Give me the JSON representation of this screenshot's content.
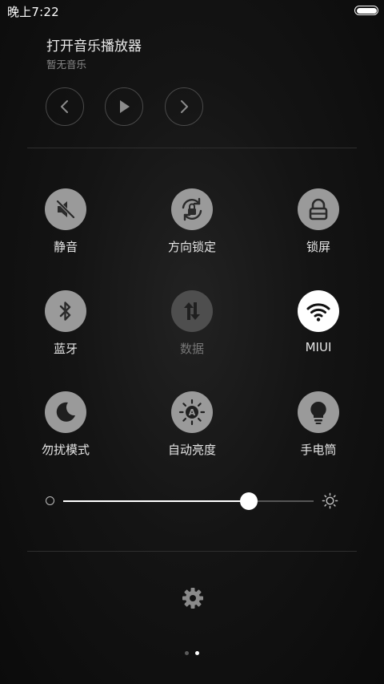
{
  "status_bar": {
    "time": "晚上7:22",
    "battery_level": 1.0
  },
  "music": {
    "title": "打开音乐播放器",
    "subtitle": "暂无音乐",
    "controls": [
      "chevron-left-icon",
      "play-icon",
      "chevron-right-icon"
    ]
  },
  "toggles": [
    {
      "label": "静音",
      "icon": "mute-icon",
      "state": "off"
    },
    {
      "label": "方向锁定",
      "icon": "rotation-lock-icon",
      "state": "off"
    },
    {
      "label": "锁屏",
      "icon": "lock-icon",
      "state": "off"
    },
    {
      "label": "蓝牙",
      "icon": "bluetooth-icon",
      "state": "off"
    },
    {
      "label": "数据",
      "icon": "mobile-data-icon",
      "state": "disabled"
    },
    {
      "label": "MIUI",
      "icon": "wifi-icon",
      "state": "on"
    },
    {
      "label": "勿扰模式",
      "icon": "moon-icon",
      "state": "off"
    },
    {
      "label": "自动亮度",
      "icon": "auto-brightness-icon",
      "state": "off"
    },
    {
      "label": "手电筒",
      "icon": "flashlight-icon",
      "state": "off"
    }
  ],
  "brightness": {
    "level": 0.74
  },
  "pager": {
    "pages": 2,
    "current": 2
  },
  "colors": {
    "tile_off": "#9a9a9a",
    "tile_on": "#ffffff",
    "tile_disabled": "#4e4e4e",
    "background": "#141414"
  }
}
